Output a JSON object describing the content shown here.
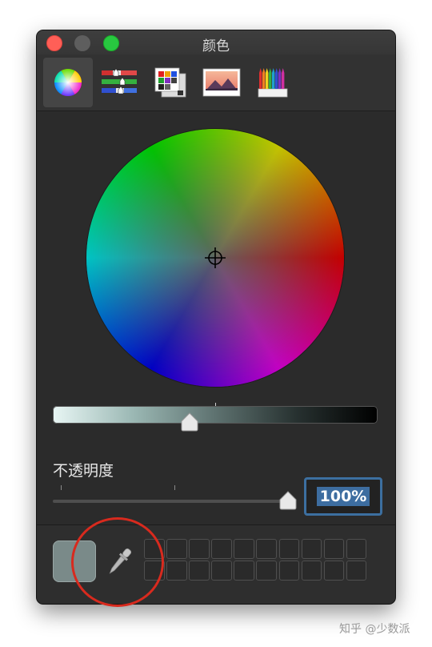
{
  "window": {
    "title": "颜色"
  },
  "toolbar": {
    "tabs": [
      {
        "icon": "color-wheel-icon"
      },
      {
        "icon": "color-sliders-icon"
      },
      {
        "icon": "color-palettes-icon"
      },
      {
        "icon": "image-palettes-icon"
      },
      {
        "icon": "pencils-icon"
      }
    ],
    "selected_index": 0
  },
  "color_wheel": {
    "brightness": 0.42
  },
  "opacity": {
    "label": "不透明度",
    "value": "100%",
    "slider_level": 1.0
  },
  "bottom": {
    "current_color": "#7a8a89",
    "saved_swatches_rows": 2,
    "saved_swatches_cols": 10
  },
  "annotation": {
    "circle_color": "#d82a1e"
  },
  "watermark": "知乎 @少数派"
}
